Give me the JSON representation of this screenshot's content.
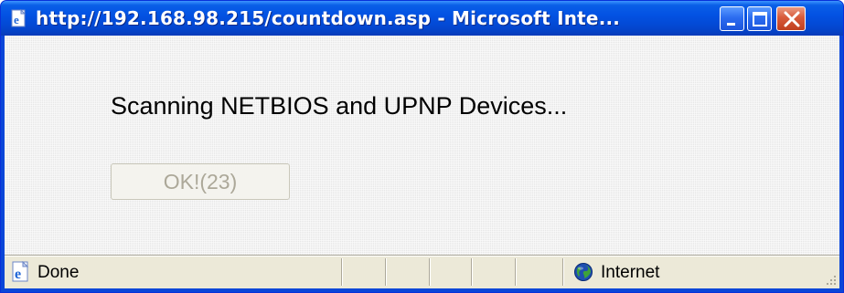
{
  "window": {
    "title": "http://192.168.98.215/countdown.asp - Microsoft Inte...",
    "title_icon": "ie-page-icon",
    "controls": {
      "minimize": "minimize-icon",
      "maximize": "maximize-icon",
      "close": "close-icon"
    }
  },
  "content": {
    "message": "Scanning NETBIOS and UPNP Devices...",
    "ok_button_label": "OK!(23)",
    "ok_button_enabled": false
  },
  "statusbar": {
    "status_text": "Done",
    "status_icon": "ie-page-icon",
    "zone_label": "Internet",
    "zone_icon": "globe-icon"
  },
  "colors": {
    "titlebar": "#0352e3",
    "close_button": "#d85a3a",
    "statusbar": "#ece9d8",
    "disabled_text": "#aca899"
  }
}
